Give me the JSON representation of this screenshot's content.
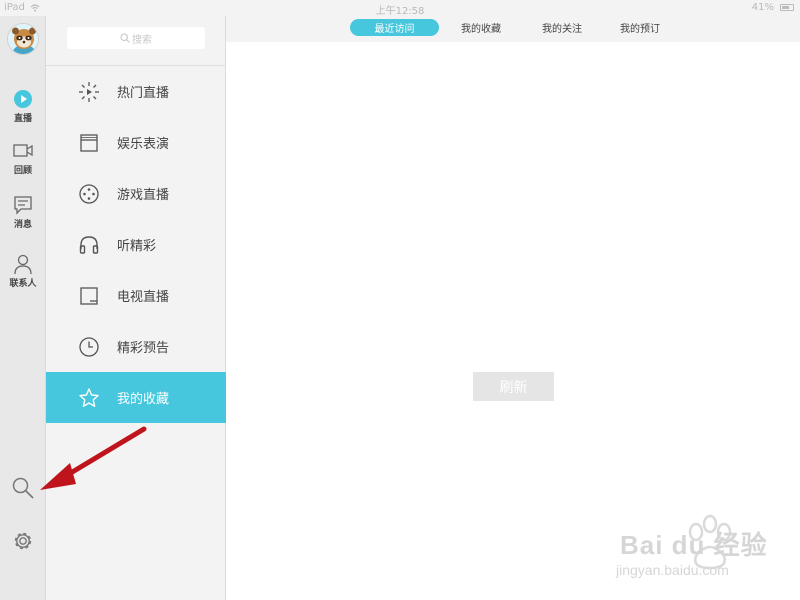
{
  "status_bar": {
    "device": "iPad",
    "time": "上午12:58",
    "battery": "41%"
  },
  "rail": {
    "items": [
      {
        "label": "直播",
        "icon": "play-circle-icon"
      },
      {
        "label": "回顾",
        "icon": "video-camera-icon"
      },
      {
        "label": "消息",
        "icon": "message-icon"
      },
      {
        "label": "联系人",
        "icon": "person-icon"
      }
    ],
    "tools": [
      {
        "icon": "search-icon"
      },
      {
        "icon": "gear-icon"
      }
    ]
  },
  "category_panel": {
    "search_placeholder": "搜索",
    "items": [
      {
        "label": "热门直播",
        "icon": "burst-play-icon"
      },
      {
        "label": "娱乐表演",
        "icon": "clapperboard-icon"
      },
      {
        "label": "游戏直播",
        "icon": "gamepad-icon"
      },
      {
        "label": "听精彩",
        "icon": "headphones-icon"
      },
      {
        "label": "电视直播",
        "icon": "tv-icon"
      },
      {
        "label": "精彩预告",
        "icon": "clock-icon"
      },
      {
        "label": "我的收藏",
        "icon": "star-icon",
        "active": true
      }
    ]
  },
  "tabs": [
    {
      "label": "最近访问",
      "active": true
    },
    {
      "label": "我的收藏"
    },
    {
      "label": "我的关注"
    },
    {
      "label": "我的预订"
    }
  ],
  "main": {
    "refresh_label": "刷新"
  },
  "watermark": {
    "text": "Bai du 经验",
    "sub": "jingyan.baidu.com"
  },
  "colors": {
    "accent": "#47c7dd",
    "annotation_arrow": "#c0141c"
  }
}
